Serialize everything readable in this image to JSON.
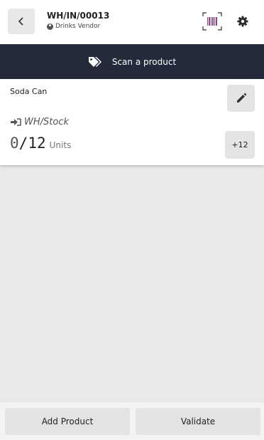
{
  "header": {
    "title": "WH/IN/00013",
    "vendor": "Drinks Vendor"
  },
  "scan_bar": {
    "label": "Scan a product"
  },
  "line": {
    "product_name": "Soda Can",
    "location": "WH/Stock",
    "qty_done": "0",
    "qty_separator": "/",
    "qty_demand": "12",
    "unit": "Units",
    "increment_label": "+12"
  },
  "footer": {
    "add_product_label": "Add Product",
    "validate_label": "Validate"
  },
  "colors": {
    "scan_bar_bg": "#252a3a",
    "page_bg": "#e9e9ea",
    "barcode_accent": "#8e4585"
  },
  "icons": {
    "back": "chevron-left-icon",
    "vendor": "user-circle-icon",
    "barcode": "barcode-icon",
    "settings": "gear-icon",
    "tags": "tags-icon",
    "edit": "pencil-icon",
    "location": "sign-in-icon"
  }
}
